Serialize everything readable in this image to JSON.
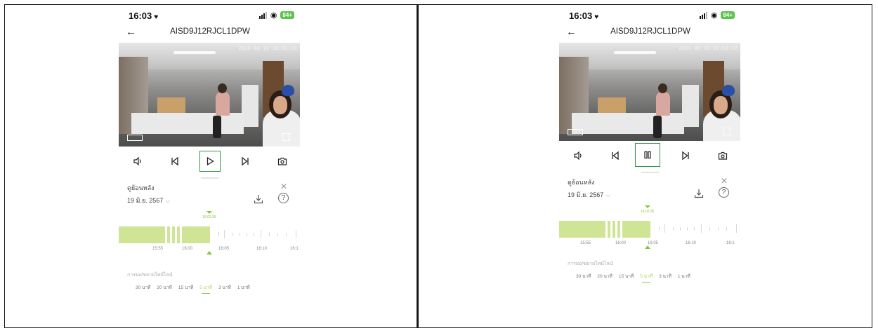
{
  "screens": [
    {
      "status": {
        "time": "16:03",
        "battery": "84+"
      },
      "title": "AISD9J12RJCL1DPW",
      "video_timestamp": "2024 06 19 16:02:36",
      "playback_icon": "play-icon",
      "marker_time": "16:02:35",
      "panel_title": "ดูย้อนหลัง",
      "date": "19 มิ.ย. 2567",
      "tick_labels": [
        "15:55",
        "16:00",
        "16:05",
        "16:10",
        "16:1"
      ],
      "speed_title": "การย่อ/ขยายไทม์ไลน์",
      "speeds": [
        "30 นาที",
        "20 นาที",
        "15 นาที",
        "5 นาที",
        "3 นาที",
        "1 นาที"
      ],
      "active_speed_index": 3
    },
    {
      "status": {
        "time": "16:03",
        "battery": "84+"
      },
      "title": "AISD9J12RJCL1DPW",
      "video_timestamp": "2024 06 19 16:02:37",
      "playback_icon": "pause-icon",
      "marker_time": "16:02:35",
      "panel_title": "ดูย้อนหลัง",
      "date": "19 มิ.ย. 2567",
      "tick_labels": [
        "15:55",
        "16:00",
        "16:05",
        "16:10",
        "16:1"
      ],
      "speed_title": "การย่อ/ขยายไทม์ไลน์",
      "speeds": [
        "30 นาที",
        "20 นาที",
        "15 นาที",
        "5 นาที",
        "3 นาที",
        "1 นาที"
      ],
      "active_speed_index": 3
    }
  ],
  "colors": {
    "accent": "#8cc63f",
    "highlight_box": "#2e9a4b",
    "timeline_fill": "#cfe495",
    "battery": "#5ec24f"
  }
}
